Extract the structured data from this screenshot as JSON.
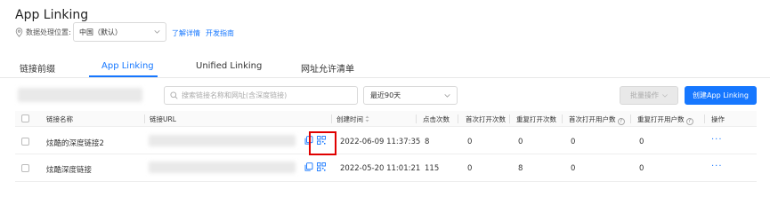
{
  "app_title": "App Linking",
  "location": {
    "label": "数据处理位置:",
    "value": "中国（默认）",
    "learn_more": "了解详情",
    "dev_guide": "开发指南"
  },
  "tabs": [
    {
      "label": "链接前缀"
    },
    {
      "label": "App Linking"
    },
    {
      "label": "Unified Linking"
    },
    {
      "label": "网址允许清单"
    }
  ],
  "toolbar": {
    "search_placeholder": "搜索链接名称和网址(含深度链接)",
    "days_value": "最近90天",
    "batch_label": "批量操作",
    "create_label": "创建App Linking"
  },
  "table": {
    "headers": [
      "链接名称",
      "链接URL",
      "创建时间",
      "点击次数",
      "首次打开次数",
      "重复打开次数",
      "首次打开用户数",
      "重复打开用户数",
      "操作"
    ],
    "rows": [
      {
        "name": "炫酷的深度链接2",
        "created": "2022-06-09 11:37:35",
        "clicks": "8",
        "first_open": "0",
        "repeat_open": "0",
        "first_users": "0",
        "repeat_users": "0",
        "action": "···"
      },
      {
        "name": "炫酷深度链接",
        "created": "2022-05-20 11:01:21",
        "clicks": "115",
        "first_open": "0",
        "repeat_open": "8",
        "first_users": "0",
        "repeat_users": "0",
        "action": "···"
      }
    ]
  },
  "colors": {
    "accent": "#1677ff",
    "highlight": "#e00000"
  }
}
